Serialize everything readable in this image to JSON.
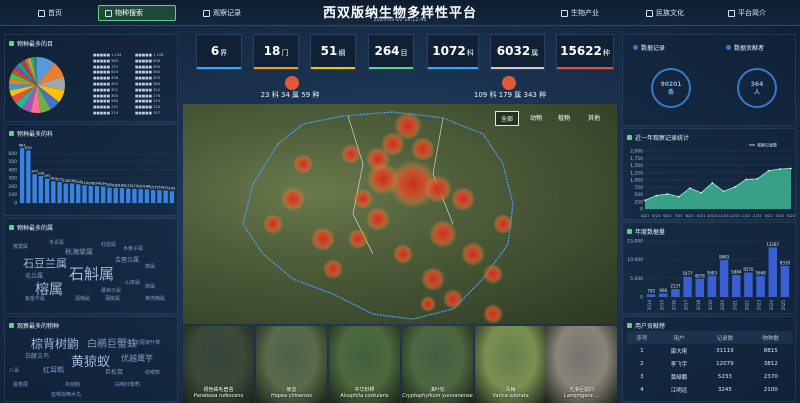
{
  "nav": {
    "home": "首页",
    "species": "物种搜索",
    "records": "观察记录",
    "industry": "生物产业",
    "culture": "民族文化",
    "about": "平台简介"
  },
  "header": {
    "title": "西双版纳生物多样性平台",
    "time": "2025-05-20 16:12:42"
  },
  "left": {
    "pie_title": "物种最多的目",
    "pie_legend": [
      "■■■■■ 1,234",
      "■■■■■ 1,128",
      "■■■■■ 983",
      "■■■■■ 856",
      "■■■■■ 721",
      "■■■■■ 690",
      "■■■■■ 604",
      "■■■■■ 560",
      "■■■■■ 498",
      "■■■■■ 455",
      "■■■■■ 402",
      "■■■■■ 380",
      "■■■■■ 351",
      "■■■■■ 322",
      "■■■■■ 300",
      "■■■■■ 276",
      "■■■■■ 260",
      "■■■■■ 243",
      "■■■■■ 231",
      "■■■■■ 220",
      "■■■■■ 214",
      "■■■■■ 207"
    ],
    "pie_colors": [
      "#5b9bd5",
      "#ed7d31",
      "#a5a5a5",
      "#ffc000",
      "#4472c4",
      "#70ad47",
      "#ff6f91",
      "#9b59b6",
      "#1abc9c",
      "#e74c3c",
      "#f1c40f",
      "#3498db",
      "#e67e22",
      "#2ecc71",
      "#d35400",
      "#8e44ad",
      "#16a085",
      "#c0392b",
      "#7f8c8d",
      "#f39c12",
      "#27ae60",
      "#2980b9"
    ],
    "pie_values": [
      12,
      10,
      9,
      8,
      7,
      7,
      6,
      6,
      5,
      5,
      4,
      4,
      4,
      3,
      3,
      3,
      3,
      3,
      2,
      2,
      2,
      2
    ],
    "bar_title": "物种最多的科",
    "family_title": "物种最多的属",
    "genus_title": "观察最多的物种"
  },
  "stats": [
    {
      "value": "6",
      "unit": "界",
      "color": "#2fa8ff"
    },
    {
      "value": "18",
      "unit": "门",
      "color": "#f39c12"
    },
    {
      "value": "51",
      "unit": "纲",
      "color": "#f1c40f"
    },
    {
      "value": "264",
      "unit": "目",
      "color": "#5fd08a"
    },
    {
      "value": "1072",
      "unit": "科",
      "color": "#2fa8ff"
    },
    {
      "value": "6032",
      "unit": "属",
      "color": "#c9c9c9"
    },
    {
      "value": "15622",
      "unit": "种",
      "color": "#e74c3c"
    }
  ],
  "kingdom_left": "23 科 34 属 59 种",
  "kingdom_right": "109 科 179 属 343 种",
  "map": {
    "tabs": [
      "全部",
      "动物",
      "植物",
      "其他"
    ]
  },
  "photos": [
    {
      "cn": "锈色蛛毛苣苔",
      "latin": "Paraboea rufescens",
      "tint": "#3d4a3a"
    },
    {
      "cn": "坡垒",
      "latin": "Hopea chinensis",
      "tint": "#5a6b4a"
    },
    {
      "cn": "中华桫椤",
      "latin": "Alsophila costularis",
      "tint": "#4c6a3c"
    },
    {
      "cn": "滇叶轮",
      "latin": "Cryptophyllium yunnanense",
      "tint": "#4d6840"
    },
    {
      "cn": "青梅",
      "latin": "Vatica odorata",
      "tint": "#7a9050"
    },
    {
      "cn": "光滑巨鼠妇",
      "latin": "Lamprigera ...",
      "tint": "#8a8478"
    }
  ],
  "right": {
    "records_title": "数据记录",
    "contrib_title": "数据贡献者",
    "records_value": "90201",
    "records_unit": "条",
    "contrib_value": "364",
    "contrib_unit": "人",
    "year_title": "近一年观察记录统计",
    "year_legend": "观察记录数",
    "annual_title": "年度数据量",
    "users_title": "用户贡献榜",
    "users_cols": [
      "序号",
      "用户",
      "记录数",
      "物种数"
    ],
    "users": [
      {
        "rank": "1",
        "name": "康大佬",
        "records": "31119",
        "species": "8815"
      },
      {
        "rank": "2",
        "name": "李飞宇",
        "records": "12079",
        "species": "3812"
      },
      {
        "rank": "3",
        "name": "黄绿鹏",
        "records": "5233",
        "species": "2370"
      },
      {
        "rank": "4",
        "name": "江明远",
        "records": "3245",
        "species": "2100"
      }
    ]
  },
  "chart_data": [
    {
      "type": "bar",
      "title": "物种最多的科",
      "categories": [
        "1",
        "2",
        "3",
        "4",
        "5",
        "6",
        "7",
        "8",
        "9",
        "10",
        "11",
        "12",
        "13",
        "14",
        "15",
        "16",
        "17",
        "18",
        "19",
        "20",
        "21",
        "22",
        "23",
        "24",
        "25"
      ],
      "values": [
        663,
        635,
        347,
        326,
        295,
        263,
        255,
        236,
        236,
        226,
        214,
        206,
        204,
        199,
        185,
        182,
        180,
        175,
        172,
        167,
        166,
        157,
        154,
        151,
        142
      ],
      "ylim": [
        0,
        700
      ],
      "yticks": [
        0,
        100,
        200,
        300,
        400,
        500,
        600
      ]
    },
    {
      "type": "area",
      "title": "近一年观察记录统计",
      "categories": [
        "4/21",
        "5/21",
        "6/21",
        "7/21",
        "8/21",
        "9/21",
        "10/21",
        "11/21",
        "12/21",
        "1/22",
        "2/22",
        "3/22",
        "4/22",
        "5/22"
      ],
      "series": [
        {
          "name": "观察记录数",
          "values": [
            300,
            460,
            520,
            420,
            720,
            560,
            900,
            610,
            760,
            1020,
            1040,
            1320,
            1380,
            1400
          ]
        }
      ],
      "ylim": [
        0,
        2000
      ],
      "yticks": [
        0,
        250,
        500,
        750,
        1000,
        1250,
        1500,
        1750,
        2000
      ]
    },
    {
      "type": "bar",
      "title": "年度数据量",
      "categories": [
        "2014",
        "2015",
        "2016",
        "2017",
        "2018",
        "2019",
        "2020",
        "2021",
        "2022",
        "2023",
        "2024",
        "2025"
      ],
      "values": [
        750,
        966,
        2137,
        5477,
        4878,
        5683,
        9883,
        5884,
        6570,
        5668,
        13287,
        8330
      ],
      "ylim": [
        0,
        15000
      ],
      "yticks": [
        0,
        5000,
        10000,
        15000
      ]
    }
  ],
  "wordcloud_genus": [
    "石豆兰属",
    "石斛属",
    "榕属",
    "秋海棠属",
    "毛兰属",
    "舌唇兰属",
    "冬青属",
    "木姜子属",
    "杜鹃属",
    "樟属",
    "菝葜属",
    "山茶属",
    "悬钩子属",
    "柿属",
    "蒲桃属",
    "紫金牛属",
    "润楠属",
    "黄肉楠属"
  ],
  "wordcloud_species": [
    "棕背树鼩",
    "白鹇巨蟹蛛",
    "黄猄蚁",
    "优越鹰芋",
    "红耳鹎",
    "巨松鼠",
    "白腰文鸟",
    "八哥",
    "长尾缝叶莺",
    "黑卷尾",
    "灰树鹊",
    "白喉红臀鹎",
    "纹喉鹎",
    "蓝喉拟啄木鸟"
  ]
}
